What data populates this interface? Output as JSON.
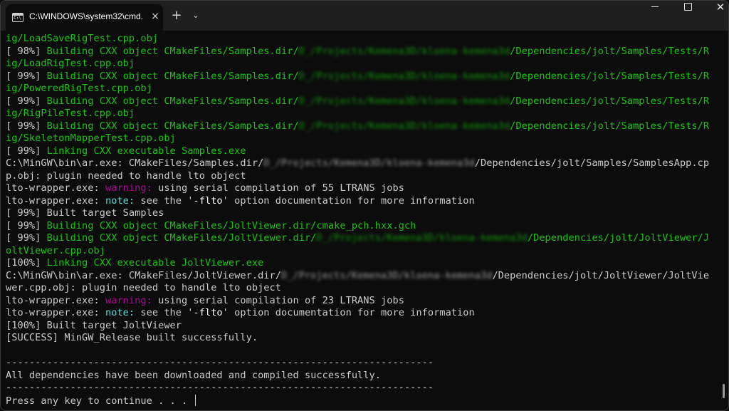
{
  "tab": {
    "title": "C:\\WINDOWS\\system32\\cmd.",
    "close": "×",
    "icon": "terminal-icon"
  },
  "toolbar": {
    "new_tab": "+",
    "dropdown": "⌄"
  },
  "window_controls": {
    "close": "✕"
  },
  "colors": {
    "background": "#0c0c0c",
    "text": "#cccccc",
    "green": "#16c60c",
    "warning": "#b4009e",
    "note": "#61d6d6"
  },
  "console": {
    "lines": [
      [
        {
          "t": "ig/LoadSaveRigTest.cpp.obj",
          "c": "g"
        }
      ],
      [
        {
          "t": "[ 98%] "
        },
        {
          "t": "Building CXX object CMakeFiles/Samples.dir/",
          "c": "g"
        },
        {
          "t": "D_/Projects/Kemena3D/kloena-kemena3d",
          "c": "g blur"
        },
        {
          "t": "/Dependencies/jolt/Samples/Tests/R",
          "c": "g"
        }
      ],
      [
        {
          "t": "ig/LoadRigTest.cpp.obj",
          "c": "g"
        }
      ],
      [
        {
          "t": "[ 99%] "
        },
        {
          "t": "Building CXX object CMakeFiles/Samples.dir/",
          "c": "g"
        },
        {
          "t": "D_/Projects/Kemena3D/kloena-kemena3d",
          "c": "g blur"
        },
        {
          "t": "/Dependencies/jolt/Samples/Tests/R",
          "c": "g"
        }
      ],
      [
        {
          "t": "ig/PoweredRigTest.cpp.obj",
          "c": "g"
        }
      ],
      [
        {
          "t": "[ 99%] "
        },
        {
          "t": "Building CXX object CMakeFiles/Samples.dir/",
          "c": "g"
        },
        {
          "t": "D_/Projects/Kemena3D/kloena-kemena3d",
          "c": "g blur"
        },
        {
          "t": "/Dependencies/jolt/Samples/Tests/R",
          "c": "g"
        }
      ],
      [
        {
          "t": "ig/RigPileTest.cpp.obj",
          "c": "g"
        }
      ],
      [
        {
          "t": "[ 99%] "
        },
        {
          "t": "Building CXX object CMakeFiles/Samples.dir/",
          "c": "g"
        },
        {
          "t": "D_/Projects/Kemena3D/kloena-kemena3d",
          "c": "g blur"
        },
        {
          "t": "/Dependencies/jolt/Samples/Tests/R",
          "c": "g"
        }
      ],
      [
        {
          "t": "ig/SkeletonMapperTest.cpp.obj",
          "c": "g"
        }
      ],
      [
        {
          "t": "[ 99%] "
        },
        {
          "t": "Linking CXX executable Samples.exe",
          "c": "g"
        }
      ],
      [
        {
          "t": "C:\\MinGW\\bin\\ar.exe: CMakeFiles/Samples.dir/"
        },
        {
          "t": "D_/Projects/Kemena3D/kloena-kemena3d",
          "c": "blur"
        },
        {
          "t": "/Dependencies/jolt/Samples/SamplesApp.cp"
        }
      ],
      [
        {
          "t": "p.obj: plugin needed to handle lto object"
        }
      ],
      [
        {
          "t": "lto-wrapper.exe: "
        },
        {
          "t": "warning:",
          "c": "m"
        },
        {
          "t": " using serial compilation of 55 LTRANS jobs"
        }
      ],
      [
        {
          "t": "lto-wrapper.exe: "
        },
        {
          "t": "note:",
          "c": "c"
        },
        {
          "t": " see the '"
        },
        {
          "t": "-flto",
          "c": "w"
        },
        {
          "t": "' option documentation for more information"
        }
      ],
      [
        {
          "t": "[ 99%] Built target Samples"
        }
      ],
      [
        {
          "t": "[ 99%] "
        },
        {
          "t": "Building CXX object CMakeFiles/JoltViewer.dir/cmake_pch.hxx.gch",
          "c": "g"
        }
      ],
      [
        {
          "t": "[ 99%] "
        },
        {
          "t": "Building CXX object CMakeFiles/JoltViewer.dir/",
          "c": "g"
        },
        {
          "t": "D_/Projects/Kemena3D/kloena-kemena3d",
          "c": "g blur"
        },
        {
          "t": "/Dependencies/jolt/JoltViewer/J",
          "c": "g"
        }
      ],
      [
        {
          "t": "oltViewer.cpp.obj",
          "c": "g"
        }
      ],
      [
        {
          "t": "[100%] "
        },
        {
          "t": "Linking CXX executable JoltViewer.exe",
          "c": "g"
        }
      ],
      [
        {
          "t": "C:\\MinGW\\bin\\ar.exe: CMakeFiles/JoltViewer.dir/"
        },
        {
          "t": "D_/Projects/Kemena3D/kloena-kemena3d",
          "c": "blur"
        },
        {
          "t": "/Dependencies/jolt/JoltViewer/JoltVie"
        }
      ],
      [
        {
          "t": "wer.cpp.obj: plugin needed to handle lto object"
        }
      ],
      [
        {
          "t": "lto-wrapper.exe: "
        },
        {
          "t": "warning:",
          "c": "m"
        },
        {
          "t": " using serial compilation of 23 LTRANS jobs"
        }
      ],
      [
        {
          "t": "lto-wrapper.exe: "
        },
        {
          "t": "note:",
          "c": "c"
        },
        {
          "t": " see the '"
        },
        {
          "t": "-flto",
          "c": "w"
        },
        {
          "t": "' option documentation for more information"
        }
      ],
      [
        {
          "t": "[100%] Built target JoltViewer"
        }
      ],
      [
        {
          "t": "[SUCCESS] MinGW_Release built successfully."
        }
      ],
      [
        {
          "t": ""
        }
      ],
      [
        {
          "t": "-------------------------------------------------------------------------"
        }
      ],
      [
        {
          "t": "All dependencies have been downloaded and compiled successfully."
        }
      ],
      [
        {
          "t": "-------------------------------------------------------------------------"
        }
      ],
      [
        {
          "t": "Press any key to continue . . . "
        }
      ]
    ]
  }
}
